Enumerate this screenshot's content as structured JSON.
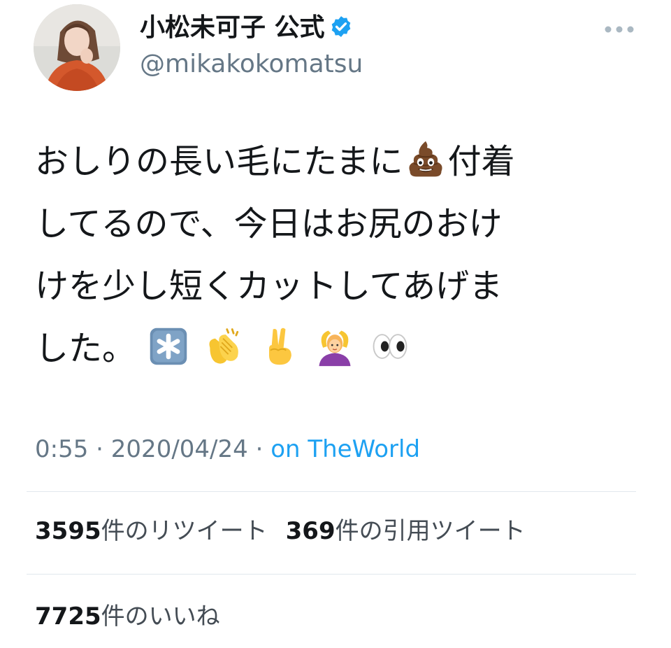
{
  "user": {
    "display_name": "小松未可子 公式",
    "handle": "@mikakokomatsu",
    "verified": true
  },
  "tweet": {
    "lines": [
      [
        "おしりの長い毛にたまに",
        "付着"
      ],
      [
        "してるので、今日はお尻のおけ"
      ],
      [
        "けを少し短くカットしてあげま"
      ],
      [
        "した。"
      ]
    ],
    "emoji": [
      "pile-of-poo",
      "asterisk",
      "clapping-hands",
      "victory-hand",
      "person-gesturing-ok",
      "eyes"
    ]
  },
  "meta": {
    "time": "0:55",
    "sep1": " · ",
    "date": "2020/04/24",
    "sep2": " · ",
    "source": "on TheWorld"
  },
  "stats": {
    "retweets_count": "3595",
    "retweets_label": "件のリツイート",
    "quotes_count": "369",
    "quotes_label": "件の引用ツイート",
    "likes_count": "7725",
    "likes_label": "件のいいね"
  },
  "colors": {
    "link": "#1da1f2",
    "secondary_text": "#657786",
    "verified_badge": "#1da1f2"
  }
}
